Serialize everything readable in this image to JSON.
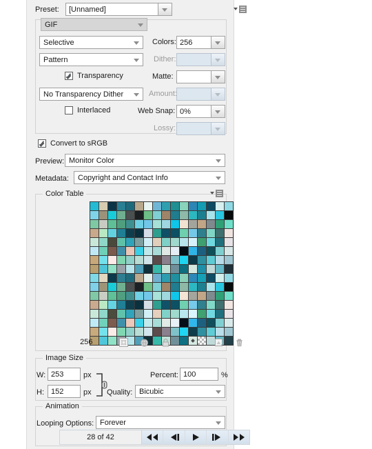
{
  "panel": {
    "preset": {
      "label": "Preset:",
      "value": "[Unnamed]",
      "menu_icon": "panel-menu-icon"
    },
    "format": {
      "value": "GIF"
    },
    "settings": {
      "reduction_algorithm": "Selective",
      "colors_label": "Colors:",
      "colors_value": "256",
      "dither_algorithm": "Pattern",
      "dither_label": "Dither:",
      "dither_value": "",
      "transparency_label": "Transparency",
      "transparency_checked": true,
      "matte_label": "Matte:",
      "matte_value": "",
      "transparency_dither": "No Transparency Dither",
      "amount_label": "Amount:",
      "amount_value": "",
      "interlaced_label": "Interlaced",
      "interlaced_checked": false,
      "web_snap_label": "Web Snap:",
      "web_snap_value": "0%",
      "lossy_label": "Lossy:",
      "lossy_value": ""
    },
    "convert_srgb": {
      "label": "Convert to sRGB",
      "checked": true
    },
    "preview": {
      "label": "Preview:",
      "value": "Monitor Color"
    },
    "metadata": {
      "label": "Metadata:",
      "value": "Copyright and Contact Info"
    },
    "color_table": {
      "title": "Color Table",
      "menu_icon": "panel-menu-icon",
      "count": "256",
      "tools": [
        {
          "name": "snap-to-web-icon"
        },
        {
          "name": "web-shift-icon"
        },
        {
          "name": "lock-color-icon"
        },
        {
          "name": "new-color-icon"
        },
        {
          "name": "delete-color-icon"
        }
      ],
      "columns": 16,
      "swatches": [
        "#23bcd4",
        "#d7cbb0",
        "#0b3547",
        "#2a7f92",
        "#1d6a7c",
        "#b9a98c",
        "#e8f5f1",
        "#6fb6d6",
        "#2f9fb0",
        "#1f8f93",
        "#89d4bb",
        "#2c86b5",
        "#149cb2",
        "#0d4b63",
        "#d7f0ef",
        "#8fd9e4",
        "#7fd4ea",
        "#9d9279",
        "#18cdd9",
        "#6fae8e",
        "#4a4f4f",
        "#1a1f22",
        "#6cbf86",
        "#7fcfd4",
        "#9e8468",
        "#1f7d8e",
        "#8fb9a8",
        "#2bb8c0",
        "#1c7f8f",
        "#a7e3ea",
        "#28c6e0",
        "#060a0a",
        "#7fc8a4",
        "#c9cbc2",
        "#5fbf96",
        "#4f9f7f",
        "#3e8f8f",
        "#6fcfe2",
        "#70c7e8",
        "#a7e0d6",
        "#9fd6df",
        "#0fc5e8",
        "#f2e2d2",
        "#a3a59c",
        "#c0a586",
        "#7e8a8d",
        "#2fa075",
        "#6fe0c9",
        "#c9a98c",
        "#b9e8c2",
        "#63d2e0",
        "#1f7f94",
        "#0e3e4e",
        "#0a2f3c",
        "#d4dce8",
        "#2f9e8f",
        "#0f5066",
        "#0d4f63",
        "#6fcfae",
        "#75c9e8",
        "#2f7f8d",
        "#7fd6c6",
        "#3f6f6f",
        "#f0e4e0",
        "#c9e8d8",
        "#8fd8c8",
        "#4a4a3c",
        "#5fc0a8",
        "#2fa3b8",
        "#7e9f9f",
        "#d0eef6",
        "#e2cfbb",
        "#7fd0c6",
        "#9fd8cc",
        "#b9e4ec",
        "#d6f2fb",
        "#3f9f6f",
        "#6fd9e0",
        "#1f6f7c",
        "#e6e2e6",
        "#bfe8f4",
        "#6fd0b8",
        "#7a5a4c",
        "#3f8fa8",
        "#e8c6b8",
        "#39cfe6",
        "#bfe8ea",
        "#a7dcd8",
        "#dfe8e4",
        "#e4eef4",
        "#050d14",
        "#2fb4e8",
        "#1d5f7e",
        "#0f4f5a",
        "#7fcfd0",
        "#d8e8e8",
        "#c7a87a",
        "#73e0ea",
        "#fbeae8",
        "#7fd6b0",
        "#8fd0c8",
        "#b9dcd4",
        "#cfe4ea",
        "#5a4a4a",
        "#8a7f8c",
        "#7fc0c8",
        "#1fd4f0",
        "#0c3a48",
        "#2f8f9f",
        "#5fcbd4",
        "#b9dce8",
        "#9fc6d2",
        "#b89f6f",
        "#4fc4d8",
        "#8fe0c4",
        "#9aa0a8",
        "#b7e4ea",
        "#4f9fb8",
        "#0f2f3a",
        "#37b8a8",
        "#bfe0d6",
        "#6f8f9a",
        "#0d6f80",
        "#d4e8e0",
        "#1f90a8",
        "#bfd8d8",
        "#63b8c6",
        "#203038",
        "#7fd9e6",
        "#e4d8c0",
        "#0b3a4a",
        "#2e7e90",
        "#1f6b7e",
        "#bca98e",
        "#e4f0ec",
        "#6fb0d0",
        "#2c9eb0",
        "#2090a0",
        "#8ad0b8",
        "#2b88b8",
        "#16a0b6",
        "#0e4c64",
        "#d4eeec",
        "#90d8e4",
        "#80d0e8",
        "#a09478",
        "#1accd8",
        "#70b090",
        "#4c5050",
        "#1b2024",
        "#6ec088",
        "#80d0d6",
        "#9f8668",
        "#207e90",
        "#90b8a6",
        "#2cb8c2",
        "#1d8090",
        "#a8e4ec",
        "#29c6e0",
        "#070b0b",
        "#80c8a6",
        "#cacdc4",
        "#60c098",
        "#509f80",
        "#409090",
        "#70d0e4",
        "#72c8ea",
        "#a8e2d8",
        "#a0d8e0",
        "#10c6ea",
        "#f3e4d4",
        "#a4a69e",
        "#c2a688",
        "#7f8c8f",
        "#30a076",
        "#70e0ca",
        "#caaa8e",
        "#bae8c4",
        "#64d4e2",
        "#208096",
        "#0f4050",
        "#0b303e",
        "#d6dee8",
        "#309f90",
        "#105268",
        "#0e5064",
        "#70d0b0",
        "#76caea",
        "#30808e",
        "#80d8c8",
        "#407070",
        "#f2e6e2",
        "#cae8da",
        "#90d8ca",
        "#4c4c3e",
        "#60c2aa",
        "#30a4ba",
        "#7fa0a0",
        "#d2f0f8",
        "#e4d0bc",
        "#80d2c8",
        "#a0dace",
        "#bae6ee",
        "#d8f4fc",
        "#40a070",
        "#70dae2",
        "#20707e",
        "#e8e4e8",
        "#c0eaf6",
        "#70d2ba",
        "#7c5c4e",
        "#4090aa",
        "#eac8ba",
        "#3ad0e8",
        "#c0eaec",
        "#a8ded8",
        "#e0eae6",
        "#e6f0f6",
        "#060e16",
        "#30b6ea",
        "#1e6080",
        "#10505c",
        "#80d0d2",
        "#d9eaea",
        "#c8aa7c",
        "#74e2ec",
        "#fcece8",
        "#80d8b2",
        "#90d2ca",
        "#bade d6",
        "#d0e6ec",
        "#5c4c4c",
        "#8b808e",
        "#80c2ca",
        "#20d6f2",
        "#0d3c4a",
        "#3090a0",
        "#60ccd6",
        "#bade ea",
        "#a0c8d4",
        "#b9a070",
        "#50c6da",
        "#90e2c6",
        "#9ba2aa",
        "#b8e6ec",
        "#50a0ba",
        "#103039",
        "#38baaa",
        "#c0e2d8",
        "#709099",
        "#0e7082",
        "#d6eae2",
        "#2092aa",
        "#c0dada",
        "#64bac8",
        "#214049"
      ],
      "last_row_web_shift_index": 251,
      "last_row_transparency_index": 252
    },
    "image_size": {
      "title": "Image Size",
      "w_label": "W:",
      "w_value": "253",
      "w_unit": "px",
      "h_label": "H:",
      "h_value": "152",
      "h_unit": "px",
      "percent_label": "Percent:",
      "percent_value": "100",
      "percent_unit": "%",
      "quality_label": "Quality:",
      "quality_value": "Bicubic",
      "chain_icon": "link-chain-icon"
    },
    "animation": {
      "title": "Animation",
      "looping_label": "Looping Options:",
      "looping_value": "Forever",
      "frame_counter": "28 of 42",
      "buttons": [
        {
          "name": "first-frame-button"
        },
        {
          "name": "previous-frame-button"
        },
        {
          "name": "play-button"
        },
        {
          "name": "next-frame-button"
        },
        {
          "name": "last-frame-button"
        }
      ]
    }
  },
  "colors": {
    "panel_bg": "#f0f0f0",
    "field_bg": "#ffffff",
    "disabled_field_bg": "#dde7f0",
    "border": "#a0a0a0",
    "text": "#1a1a1a",
    "disabled_text": "#9a9a9a"
  }
}
